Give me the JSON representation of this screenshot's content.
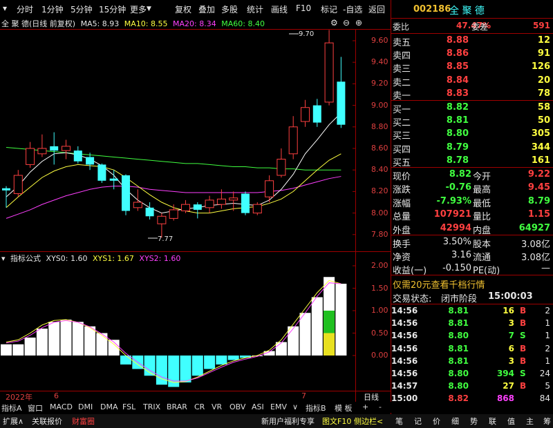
{
  "toolbar": {
    "items": [
      "分时",
      "1分钟",
      "5分钟",
      "15分钟",
      "更多",
      "复权",
      "叠加",
      "多股",
      "统计",
      "画线",
      "F10",
      "标记",
      "-自选",
      "返回"
    ]
  },
  "chart_header": {
    "name": "全 聚 德(日线 前复权)",
    "ma5": "MA5: 8.93",
    "ma10": "MA10: 8.55",
    "ma20": "MA20: 8.34",
    "ma60": "MA60: 8.40"
  },
  "price_axis": [
    "9.60",
    "9.40",
    "9.20",
    "9.00",
    "8.80",
    "8.60",
    "8.40",
    "8.20",
    "8.00",
    "7.80"
  ],
  "annotations": {
    "high": "9.70",
    "low": "7.77"
  },
  "indicator_header": {
    "name": "指标公式",
    "xys0": "XYS0: 1.60",
    "xys1": "XYS1: 1.67",
    "xys2": "XYS2: 1.60"
  },
  "indicator_axis": [
    "2.00",
    "1.50",
    "1.00",
    "0.50",
    "0.00"
  ],
  "time_axis": {
    "start": "2022年",
    "m1": "6",
    "m2": "7",
    "period": "日线"
  },
  "bottom_tabs": [
    "指标A",
    "窗口",
    "MACD",
    "DMI",
    "DMA",
    "FSL",
    "TRIX",
    "BRAR",
    "CR",
    "VR",
    "OBV",
    "ASI",
    "EMV",
    "∨",
    "指标B",
    "模 板",
    "+",
    "-"
  ],
  "status_left": [
    "扩展∧",
    "关联报价",
    "财富圈"
  ],
  "status_mid": [
    "新用户福利专享",
    "图文F10",
    "侧边栏<"
  ],
  "status_right": [
    "笔",
    "记",
    "价",
    "细",
    "势",
    "联",
    "值",
    "主",
    "筹"
  ],
  "stock": {
    "code": "002186",
    "name": "全 聚 德"
  },
  "weibi": {
    "label1": "委比",
    "val1": "47.47%",
    "label2": "委差",
    "val2": "591"
  },
  "sell_orders": [
    {
      "label": "卖五",
      "price": "8.88",
      "vol": "12"
    },
    {
      "label": "卖四",
      "price": "8.86",
      "vol": "91"
    },
    {
      "label": "卖三",
      "price": "8.85",
      "vol": "126"
    },
    {
      "label": "卖二",
      "price": "8.84",
      "vol": "20"
    },
    {
      "label": "卖一",
      "price": "8.83",
      "vol": "78"
    }
  ],
  "buy_orders": [
    {
      "label": "买一",
      "price": "8.82",
      "vol": "58"
    },
    {
      "label": "买二",
      "price": "8.81",
      "vol": "50"
    },
    {
      "label": "买三",
      "price": "8.80",
      "vol": "305"
    },
    {
      "label": "买四",
      "price": "8.79",
      "vol": "344"
    },
    {
      "label": "买五",
      "price": "8.78",
      "vol": "161"
    }
  ],
  "quote": [
    {
      "l1": "现价",
      "v1": "8.82",
      "l2": "今开",
      "v2": "9.22"
    },
    {
      "l1": "涨跌",
      "v1": "-0.76",
      "l2": "最高",
      "v2": "9.45"
    },
    {
      "l1": "涨幅",
      "v1": "-7.93%",
      "l2": "最低",
      "v2": "8.79"
    },
    {
      "l1": "总量",
      "v1": "107921",
      "l2": "量比",
      "v2": "1.15"
    },
    {
      "l1": "外盘",
      "v1": "42994",
      "l2": "内盘",
      "v2": "64927"
    }
  ],
  "stats": [
    {
      "l1": "换手",
      "v1": "3.50%",
      "l2": "股本",
      "v2": "3.08亿"
    },
    {
      "l1": "净资",
      "v1": "3.16",
      "l2": "流通",
      "v2": "3.08亿"
    },
    {
      "l1": "收益(一)",
      "v1": "-0.150",
      "l2": "PE(动)",
      "v2": "—"
    }
  ],
  "promo": "仅需20元查看千档行情",
  "trade_status": {
    "label": "交易状态:",
    "value": "闭市阶段",
    "time": "15:00:03"
  },
  "ticks": [
    {
      "time": "14:56",
      "price": "8.81",
      "vol": "16",
      "side": "B",
      "n": "2"
    },
    {
      "time": "14:56",
      "price": "8.81",
      "vol": "3",
      "side": "B",
      "n": "1"
    },
    {
      "time": "14:56",
      "price": "8.80",
      "vol": "7",
      "side": "S",
      "n": "1"
    },
    {
      "time": "14:56",
      "price": "8.81",
      "vol": "6",
      "side": "B",
      "n": "2"
    },
    {
      "time": "14:56",
      "price": "8.81",
      "vol": "3",
      "side": "B",
      "n": "1"
    },
    {
      "time": "14:56",
      "price": "8.80",
      "vol": "394",
      "side": "S",
      "n": "24"
    },
    {
      "time": "14:57",
      "price": "8.80",
      "vol": "27",
      "side": "B",
      "n": "5"
    },
    {
      "time": "15:00",
      "price": "8.82",
      "vol": "868",
      "side": "",
      "n": "84"
    }
  ],
  "colors": {
    "up": "#ff4040",
    "down": "#40ffff",
    "ma5": "#ffffff",
    "ma10": "#ffff40",
    "ma20": "#ff40ff",
    "ma60": "#40ff40"
  }
}
